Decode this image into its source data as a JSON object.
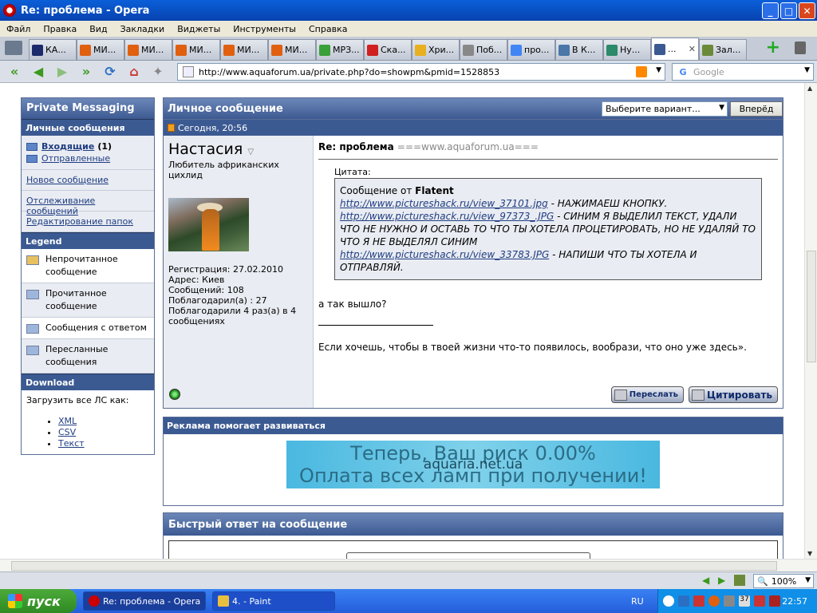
{
  "window": {
    "title": "Re: проблема - Opera",
    "controls": {
      "minimize": "_",
      "maximize": "□",
      "close": "✕"
    }
  },
  "menu": [
    "Файл",
    "Правка",
    "Вид",
    "Закладки",
    "Виджеты",
    "Инструменты",
    "Справка"
  ],
  "tabs": [
    {
      "label": "КА...",
      "icon_color": "#1b2a6b"
    },
    {
      "label": "МИ...",
      "icon_color": "#e06010"
    },
    {
      "label": "МИ...",
      "icon_color": "#e06010"
    },
    {
      "label": "МИ...",
      "icon_color": "#e06010"
    },
    {
      "label": "МИ...",
      "icon_color": "#e06010"
    },
    {
      "label": "МИ...",
      "icon_color": "#e06010"
    },
    {
      "label": "МРЗ...",
      "icon_color": "#3aa03a"
    },
    {
      "label": "Ска...",
      "icon_color": "#d02020"
    },
    {
      "label": "Хри...",
      "icon_color": "#e8b020"
    },
    {
      "label": "Поб...",
      "icon_color": "#888888"
    },
    {
      "label": "про...",
      "icon_color": "#4285f4"
    },
    {
      "label": "В К...",
      "icon_color": "#4a76a8"
    },
    {
      "label": "Ну...",
      "icon_color": "#2a8a6a"
    },
    {
      "label": "...",
      "icon_color": "#3c5a92",
      "active": true
    },
    {
      "label": "Зал...",
      "icon_color": "#6a8a3a"
    }
  ],
  "nav": {
    "url": "http://www.aquaforum.ua/private.php?do=showpm&pmid=1528853",
    "search_placeholder": "Google"
  },
  "sidebar": {
    "title": "Private Messaging",
    "messages_header": "Личные сообщения",
    "inbox_label": "Входящие",
    "inbox_count": "(1)",
    "sent_label": "Отправленные",
    "links": [
      "Новое сообщение",
      "Отслеживание сообщений",
      "Редактирование папок"
    ],
    "legend_header": "Legend",
    "legend": [
      {
        "label": "Непрочитанное сообщение",
        "icon_color": "#e8c060"
      },
      {
        "label": "Прочитанное сообщение",
        "icon_color": "#9fb6dc"
      },
      {
        "label": "Сообщения с ответом",
        "icon_color": "#9fb6dc"
      },
      {
        "label": "Пересланные сообщения",
        "icon_color": "#9fb6dc"
      }
    ],
    "download_header": "Download",
    "download_text": "Загрузить все ЛС как:",
    "download_formats": [
      "XML",
      "CSV",
      "Текст"
    ]
  },
  "message": {
    "header": "Личное сообщение",
    "select_value": "Выберите вариант...",
    "forward_button": "Вперёд",
    "date": "Сегодня, 20:56",
    "user": {
      "name": "Настасия",
      "title": "Любитель африканских цихлид",
      "registered": "Регистрация: 27.02.2010",
      "address": "Адрес: Киев",
      "posts": "Сообщений: 108",
      "thanked": "Поблагодарил(а) : 27",
      "thanks_received": "Поблагодарили 4 раз(а) в 4 сообщениях"
    },
    "subject": "Re: проблема",
    "subject_site": "===www.aquaforum.ua===",
    "quote_label": "Цитата:",
    "quote_from_prefix": "Сообщение от",
    "quote_author": "Flatent",
    "quote_lines": [
      {
        "link": "http://www.pictureshack.ru/view_37101.jpg",
        "text": " - НАЖИМАЕШ КНОПКУ."
      },
      {
        "link": "http://www.pictureshack.ru/view_97373_.JPG",
        "text": " - СИНИМ Я ВЫДЕЛИЛ ТЕКСТ, УДАЛИ ЧТО НЕ НУЖНО И ОСТАВЬ ТО ЧТО ТЫ ХОТЕЛА ПРОЦЕТИРОВАТЬ, НО НЕ УДАЛЯЙ ТО ЧТО Я НЕ ВЫДЕЛЯЛ СИНИМ"
      },
      {
        "link": "http://www.pictureshack.ru/view_33783.JPG",
        "text": " - НАПИШИ ЧТО ТЫ ХОТЕЛА И ОТПРАВЛЯЙ."
      }
    ],
    "body": "а так вышло?",
    "signature": "Если хочешь, чтобы в твоей жизни что-то появилось, вообрази, что оно уже здесь».",
    "btn_forward": "Переслать",
    "btn_quote": "Цитировать"
  },
  "ad": {
    "header": "Реклама помогает развиваться",
    "line1": "Теперь, Ваш риск 0.00%",
    "brand": "aquaria.net.ua",
    "line2": "Оплата всех ламп при получении!"
  },
  "quick_reply": {
    "header": "Быстрый ответ на сообщение"
  },
  "status": {
    "zoom": "100%"
  },
  "taskbar": {
    "start": "пуск",
    "tasks": [
      {
        "label": "Re: проблема - Opera",
        "active": true
      },
      {
        "label": "4. - Paint",
        "active": false
      }
    ],
    "lang": "RU",
    "tray_count": "37",
    "clock": "22:57"
  }
}
